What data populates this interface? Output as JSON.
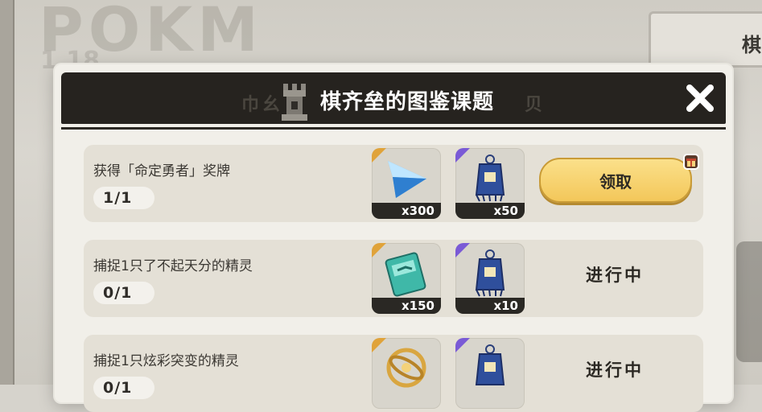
{
  "background": {
    "logo": "POKM",
    "logo_sub": "1.18",
    "card_text": "棋"
  },
  "dialog": {
    "title": "棋齐垒的图鉴课题",
    "title_ghost_left": "巾幺",
    "title_ghost_right": "贝",
    "close_icon": "close-x-icon"
  },
  "tasks": [
    {
      "name": "获得「命定勇者」奖牌",
      "progress": "1/1",
      "rewards": [
        {
          "icon": "blue-crystal-icon",
          "qty": "x300",
          "rarity_color": "#e0a33a"
        },
        {
          "icon": "blue-charm-ticket-icon",
          "qty": "x50",
          "rarity_color": "#7a5ad6"
        }
      ],
      "action": {
        "type": "button",
        "label": "领取"
      }
    },
    {
      "name": "捕捉1只了不起天分的精灵",
      "progress": "0/1",
      "rewards": [
        {
          "icon": "exp-book-icon",
          "qty": "x150",
          "rarity_color": "#e0a33a"
        },
        {
          "icon": "blue-charm-ticket-icon",
          "qty": "x10",
          "rarity_color": "#7a5ad6"
        }
      ],
      "action": {
        "type": "status",
        "label": "进行中"
      }
    },
    {
      "name": "捕捉1只炫彩突变的精灵",
      "progress": "0/1",
      "rewards": [
        {
          "icon": "golden-ring-icon",
          "qty": "",
          "rarity_color": "#e0a33a"
        },
        {
          "icon": "blue-charm-ticket-icon",
          "qty": "",
          "rarity_color": "#7a5ad6"
        }
      ],
      "action": {
        "type": "status",
        "label": "进行中"
      }
    }
  ],
  "colors": {
    "titlebar": "#26231f",
    "claim_button": "#f3c75a",
    "row_bg": "#e4e0d6"
  }
}
